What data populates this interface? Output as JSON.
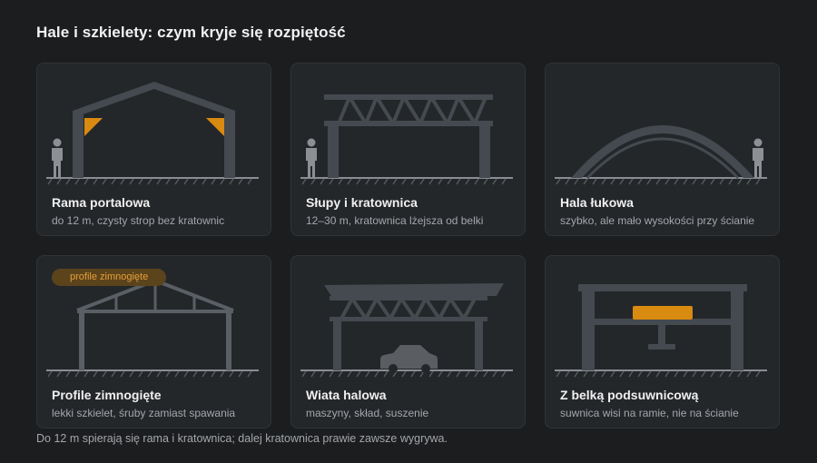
{
  "title": "Hale i szkielety: czym kryje się rozpiętość",
  "cards": [
    {
      "title": "Rama portalowa",
      "subtitle": "do 12 m, czysty strop bez kratownic",
      "icon": "portal-frame-icon"
    },
    {
      "title": "Słupy i kratownica",
      "subtitle": "12–30 m, kratownica lżejsza od belki",
      "icon": "columns-truss-icon"
    },
    {
      "title": "Hala łukowa",
      "subtitle": "szybko, ale mało wysokości przy ścianie",
      "icon": "arch-hall-icon"
    },
    {
      "title": "Profile zimnogięte",
      "subtitle": "lekki szkielet, śruby zamiast spawania",
      "badge": "profile zimnogięte",
      "icon": "cold-formed-frame-icon"
    },
    {
      "title": "Wiata halowa",
      "subtitle": "maszyny, skład, suszenie",
      "icon": "open-shed-icon"
    },
    {
      "title": "Z belką podsuwnicową",
      "subtitle": "suwnica wisi na ramie, nie na ścianie",
      "icon": "crane-beam-icon"
    }
  ],
  "footer": "Do 12 m spierają się rama i kratownica; dalej kratownica prawie zawsze wygrywa.",
  "colors": {
    "background": "#1b1d1f",
    "card": "#24272a",
    "structure": "#454a50",
    "accent": "#d98a10",
    "person": "#8c9094"
  }
}
